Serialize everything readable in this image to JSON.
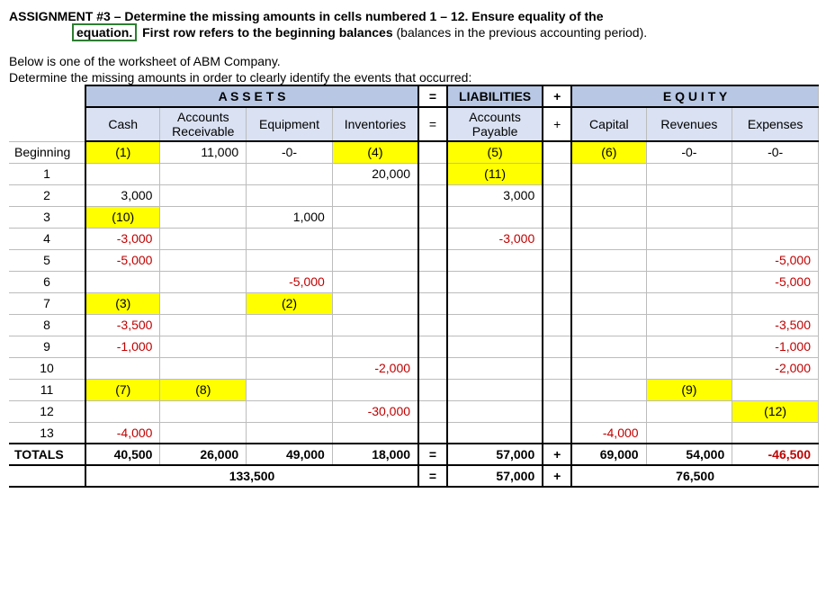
{
  "title": {
    "line1_a": "ASSIGNMENT #3 – Determine the missing amounts in cells numbered 1 – 12.  Ensure equality of the",
    "equation_word": "equation.",
    "line2_bold": "First row refers to the beginning balances",
    "line2_rest": " (balances in the previous accounting period)."
  },
  "intro": {
    "l1": "Below is one of the worksheet of ABM Company.",
    "l2": "Determine the missing amounts in order to clearly identify the events that occurred:"
  },
  "headers": {
    "assets": "A S S E T S",
    "eq": "=",
    "liab": "LIABILITIES",
    "plus": "+",
    "equity": "E Q U I T Y",
    "cash": "Cash",
    "ar": "Accounts Receivable",
    "equip": "Equipment",
    "inv": "Inventories",
    "ap": "Accounts Payable",
    "cap": "Capital",
    "rev": "Revenues",
    "exp": "Expenses"
  },
  "rows": [
    {
      "label": "Beginning",
      "cash": "(1)",
      "cash_hl": true,
      "ar": "11,000",
      "equip": "-0-",
      "inv": "(4)",
      "inv_hl": true,
      "ap": "(5)",
      "ap_hl": true,
      "cap": "(6)",
      "cap_hl": true,
      "rev": "-0-",
      "exp": "-0-"
    },
    {
      "label": "1",
      "inv": "20,000",
      "ap": "(11)",
      "ap_hl": true
    },
    {
      "label": "2",
      "cash": "3,000",
      "ap": "3,000"
    },
    {
      "label": "3",
      "cash": "(10)",
      "cash_hl": true,
      "equip": "1,000"
    },
    {
      "label": "4",
      "cash": "-3,000",
      "cash_neg": true,
      "ap": "-3,000",
      "ap_neg": true
    },
    {
      "label": "5",
      "cash": "-5,000",
      "cash_neg": true,
      "exp": "-5,000",
      "exp_neg": true
    },
    {
      "label": "6",
      "equip": "-5,000",
      "equip_neg": true,
      "exp": "-5,000",
      "exp_neg": true
    },
    {
      "label": "7",
      "cash": "(3)",
      "cash_hl": true,
      "equip": "(2)",
      "equip_hl": true
    },
    {
      "label": "8",
      "cash": "-3,500",
      "cash_neg": true,
      "exp": "-3,500",
      "exp_neg": true
    },
    {
      "label": "9",
      "cash": "-1,000",
      "cash_neg": true,
      "exp": "-1,000",
      "exp_neg": true
    },
    {
      "label": "10",
      "inv": "-2,000",
      "inv_neg": true,
      "exp": "-2,000",
      "exp_neg": true
    },
    {
      "label": "11",
      "cash": "(7)",
      "cash_hl": true,
      "ar": "(8)",
      "ar_hl": true,
      "rev": "(9)",
      "rev_hl": true
    },
    {
      "label": "12",
      "inv": "-30,000",
      "inv_neg": true,
      "exp": "(12)",
      "exp_hl": true
    },
    {
      "label": "13",
      "cash": "-4,000",
      "cash_neg": true,
      "cap": "-4,000",
      "cap_neg": true
    }
  ],
  "totals": {
    "label": "TOTALS",
    "cash": "40,500",
    "ar": "26,000",
    "equip": "49,000",
    "inv": "18,000",
    "eq": "=",
    "ap": "57,000",
    "plus": "+",
    "cap": "69,000",
    "rev": "54,000",
    "exp": "-46,500",
    "exp_neg": true
  },
  "grand": {
    "assets_total": "133,500",
    "eq": "=",
    "ap": "57,000",
    "plus": "+",
    "equity_total": "76,500"
  },
  "chart_data": {
    "type": "table",
    "title": "Accounting Equation Worksheet — ABM Company",
    "columns": [
      "Row",
      "Cash",
      "Accounts Receivable",
      "Equipment",
      "Inventories",
      "=",
      "Accounts Payable",
      "+",
      "Capital",
      "Revenues",
      "Expenses"
    ],
    "rows": [
      [
        "Beginning",
        "(1)",
        "11,000",
        "-0-",
        "(4)",
        "",
        "(5)",
        "",
        "(6)",
        "-0-",
        "-0-"
      ],
      [
        "1",
        "",
        "",
        "",
        "20,000",
        "",
        "(11)",
        "",
        "",
        "",
        ""
      ],
      [
        "2",
        "3,000",
        "",
        "",
        "",
        "",
        "3,000",
        "",
        "",
        "",
        ""
      ],
      [
        "3",
        "(10)",
        "",
        "1,000",
        "",
        "",
        "",
        "",
        "",
        "",
        ""
      ],
      [
        "4",
        "-3,000",
        "",
        "",
        "",
        "",
        "-3,000",
        "",
        "",
        "",
        ""
      ],
      [
        "5",
        "-5,000",
        "",
        "",
        "",
        "",
        "",
        "",
        "",
        "",
        "-5,000"
      ],
      [
        "6",
        "",
        "",
        "-5,000",
        "",
        "",
        "",
        "",
        "",
        "",
        "-5,000"
      ],
      [
        "7",
        "(3)",
        "",
        "(2)",
        "",
        "",
        "",
        "",
        "",
        "",
        ""
      ],
      [
        "8",
        "-3,500",
        "",
        "",
        "",
        "",
        "",
        "",
        "",
        "",
        "-3,500"
      ],
      [
        "9",
        "-1,000",
        "",
        "",
        "",
        "",
        "",
        "",
        "",
        "",
        "-1,000"
      ],
      [
        "10",
        "",
        "",
        "",
        "-2,000",
        "",
        "",
        "",
        "",
        "",
        "-2,000"
      ],
      [
        "11",
        "(7)",
        "(8)",
        "",
        "",
        "",
        "",
        "",
        "",
        "(9)",
        ""
      ],
      [
        "12",
        "",
        "",
        "",
        "-30,000",
        "",
        "",
        "",
        "",
        "",
        "(12)"
      ],
      [
        "13",
        "-4,000",
        "",
        "",
        "",
        "",
        "",
        "",
        "-4,000",
        "",
        ""
      ],
      [
        "TOTALS",
        "40,500",
        "26,000",
        "49,000",
        "18,000",
        "=",
        "57,000",
        "+",
        "69,000",
        "54,000",
        "-46,500"
      ],
      [
        "",
        "",
        "",
        "133,500",
        "",
        "=",
        "57,000",
        "+",
        "",
        "76,500",
        ""
      ]
    ]
  }
}
